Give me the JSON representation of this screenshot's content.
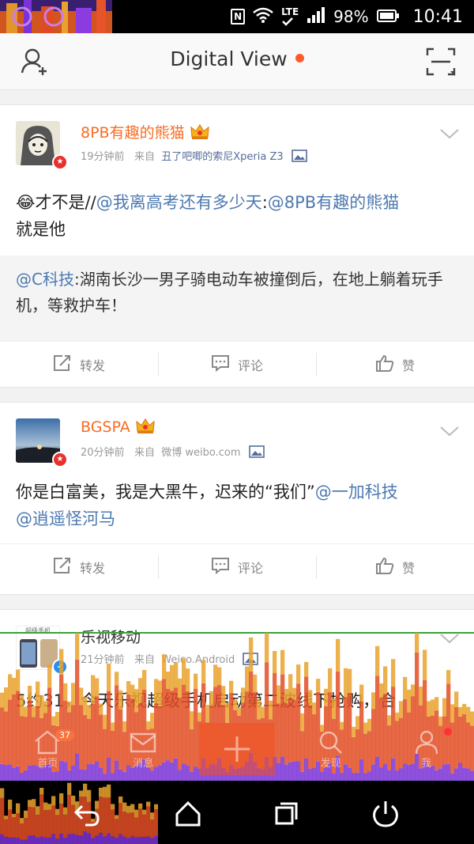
{
  "status_bar": {
    "nfc": "N",
    "network": "LTE",
    "battery": "98%",
    "time": "10:41"
  },
  "header": {
    "title": "Digital View"
  },
  "posts": [
    {
      "author": "8PB有趣的熊猫",
      "time": "19分钟前",
      "from_label": "来自",
      "source": "丑了吧唧的索尼Xperia Z3",
      "text_emoji": "😂",
      "text_a": "才不是//",
      "mention_1": "@我离高考还有多少天",
      "text_b": ":",
      "mention_2": "@8PB有趣的熊猫",
      "text_c": "就是他",
      "repost_mention": "@C科技",
      "repost_text": ":湖南长沙一男子骑电动车被撞倒后，在地上躺着玩手机，等救护车！",
      "actions": {
        "repost": "转发",
        "comment": "评论",
        "like": "赞"
      }
    },
    {
      "author": "BGSPA",
      "time": "20分钟前",
      "from_label": "来自",
      "source": "微博 weibo.com",
      "text_a": "你是白富美，我是大黑牛，迟来的“我们”",
      "mention_1": "@一加科技",
      "mention_2": "@逍遥怪河马",
      "actions": {
        "repost": "转发",
        "comment": "评论",
        "like": "赞"
      }
    },
    {
      "author": "乐视移动",
      "avatar_label": "超级手机",
      "time": "21分钟前",
      "from_label": "来自",
      "source": "Weico.Android",
      "text_a": "5约31，今天乐视超级手机启动第二波线下抢购，合"
    }
  ],
  "bottom_tabs": {
    "home": "首页",
    "home_count": "37",
    "messages": "消息",
    "discover": "发现",
    "me": "我"
  }
}
